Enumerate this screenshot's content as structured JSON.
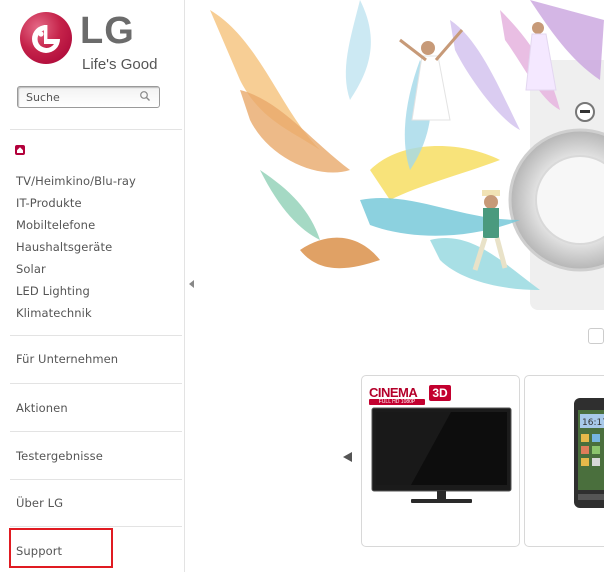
{
  "brand": {
    "logo_text": "LG",
    "tagline": "Life's Good",
    "color": "#a50034"
  },
  "search": {
    "placeholder": "Suche"
  },
  "sidebar": {
    "home_icon": "home-icon",
    "products": [
      "TV/Heimkino/Blu-ray",
      "IT-Produkte",
      "Mobiltelefone",
      "Haushaltsgeräte",
      "Solar",
      "LED Lighting",
      "Klimatechnik"
    ],
    "sections": [
      "Für Unternehmen",
      "Aktionen",
      "Testergebnisse",
      "Über LG",
      "Support"
    ],
    "highlight_color": "#e01b22"
  },
  "carousel": {
    "prev_icon": "chevron-left-icon",
    "tv_badge": {
      "brand": "CINEMA",
      "tag": "3D",
      "sub": "FULL HD 1080P"
    }
  }
}
